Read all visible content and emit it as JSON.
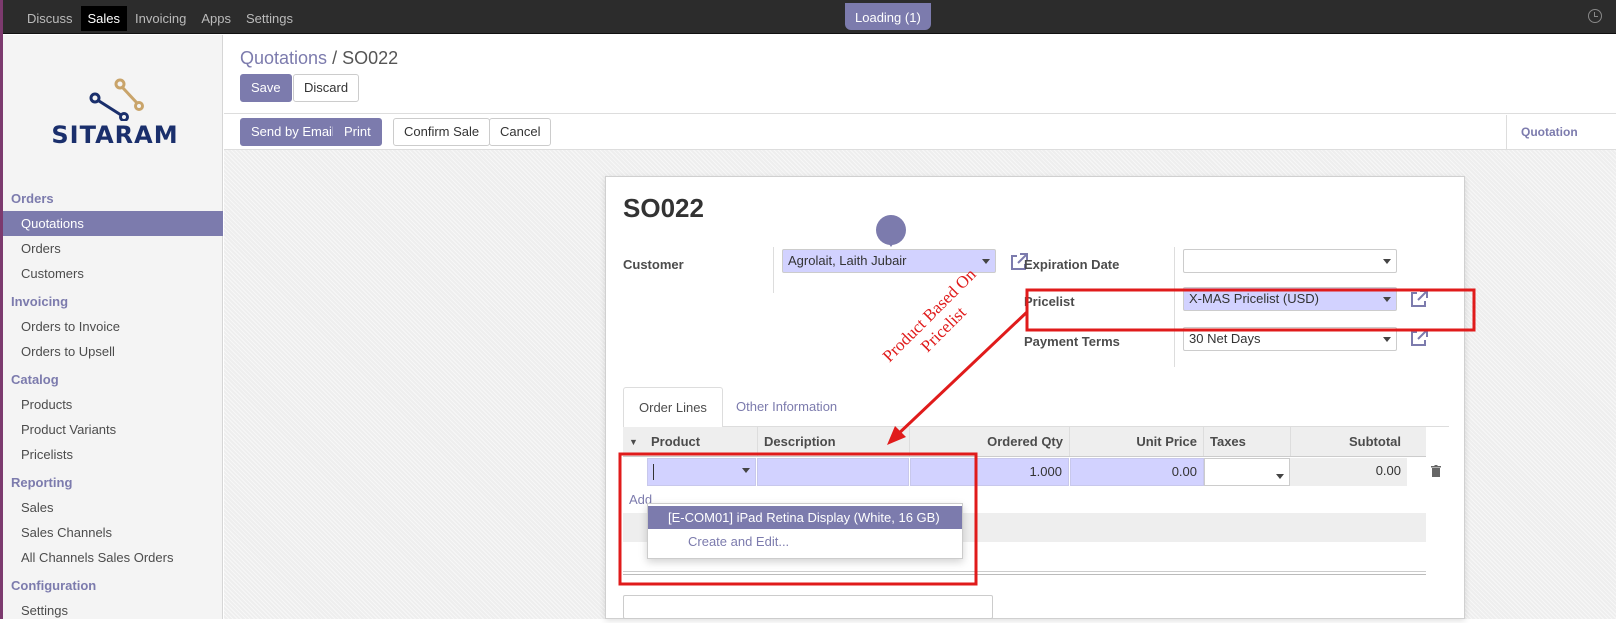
{
  "topbar": {
    "menu": [
      "Discuss",
      "Sales",
      "Invoicing",
      "Apps",
      "Settings"
    ],
    "active_menu": "Sales",
    "loading": "Loading (1)",
    "clock_icon": "clock-icon"
  },
  "logo": {
    "text": "SITARAM"
  },
  "sidebar": {
    "sections": [
      {
        "title": "Orders",
        "items": [
          "Quotations",
          "Orders",
          "Customers"
        ]
      },
      {
        "title": "Invoicing",
        "items": [
          "Orders to Invoice",
          "Orders to Upsell"
        ]
      },
      {
        "title": "Catalog",
        "items": [
          "Products",
          "Product Variants",
          "Pricelists"
        ]
      },
      {
        "title": "Reporting",
        "items": [
          "Sales",
          "Sales Channels",
          "All Channels Sales Orders"
        ]
      },
      {
        "title": "Configuration",
        "items": [
          "Settings"
        ]
      }
    ],
    "active_item": "Quotations"
  },
  "breadcrumb": {
    "parent": "Quotations",
    "separator": "/",
    "current": "SO022"
  },
  "buttons": {
    "save": "Save",
    "discard": "Discard",
    "send_email": "Send by Email",
    "print": "Print",
    "confirm": "Confirm Sale",
    "cancel": "Cancel"
  },
  "status": {
    "stage": "Quotation"
  },
  "form": {
    "title": "SO022",
    "customer_label": "Customer",
    "customer_value": "Agrolait, Laith Jubair",
    "expiration_label": "Expiration Date",
    "expiration_value": "",
    "pricelist_label": "Pricelist",
    "pricelist_value": "X-MAS Pricelist (USD)",
    "payment_label": "Payment Terms",
    "payment_value": "30 Net Days"
  },
  "tabs": {
    "order_lines": "Order Lines",
    "other_info": "Other Information"
  },
  "table": {
    "headers": {
      "product": "Product",
      "description": "Description",
      "qty": "Ordered Qty",
      "price": "Unit Price",
      "taxes": "Taxes",
      "subtotal": "Subtotal"
    },
    "row": {
      "product": "",
      "description": "",
      "qty": "1.000",
      "price": "0.00",
      "taxes": "",
      "subtotal": "0.00"
    },
    "add_line": "Add"
  },
  "dropdown": {
    "option": "[E-COM01] iPad Retina Display (White, 16 GB)",
    "create": "Create and Edit..."
  },
  "annotation": {
    "line1": "Product Based On",
    "line2": "Pricelist",
    "color": "#e01b1b"
  },
  "colors": {
    "accent": "#7c7bad",
    "topbar": "#2c2c2c",
    "required_field": "#d2d2ff"
  }
}
